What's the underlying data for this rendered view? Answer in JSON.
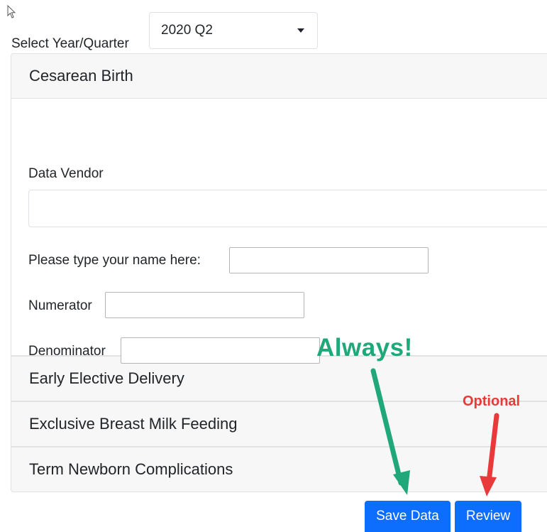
{
  "year_quarter": {
    "label": "Select Year/Quarter",
    "selected": "2020 Q2"
  },
  "sections": [
    {
      "title": "Cesarean Birth",
      "expanded": true
    },
    {
      "title": "Early Elective Delivery",
      "expanded": false
    },
    {
      "title": "Exclusive Breast Milk Feeding",
      "expanded": false
    },
    {
      "title": "Term Newborn Complications",
      "expanded": false
    }
  ],
  "form": {
    "data_vendor_label": "Data Vendor",
    "data_vendor_value": "",
    "name_label": "Please type your name here:",
    "name_value": "",
    "numerator_label": "Numerator",
    "numerator_value": "",
    "denominator_label": "Denominator",
    "denominator_value": ""
  },
  "buttons": {
    "save": "Save Data",
    "review": "Review"
  },
  "annotations": {
    "always": "Always!",
    "always_color": "#20a77a",
    "optional": "Optional",
    "optional_color": "#e83a3a"
  },
  "colors": {
    "button_primary": "#0d6efd",
    "header_bg": "#f7f7f7"
  }
}
